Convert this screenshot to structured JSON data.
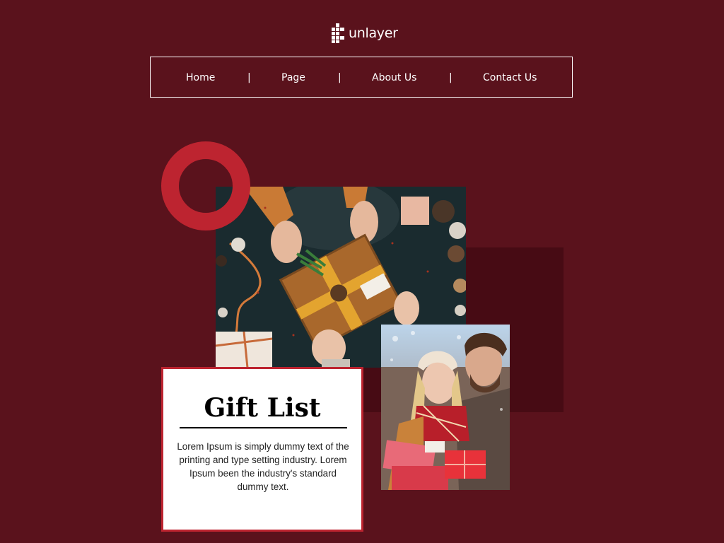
{
  "brand": {
    "name": "unlayer",
    "logo_icon": "unlayer-logo-icon"
  },
  "nav": {
    "items": [
      {
        "label": "Home"
      },
      {
        "label": "Page"
      },
      {
        "label": "About Us"
      },
      {
        "label": "Contact Us"
      }
    ],
    "separator": "|"
  },
  "card": {
    "title": "Gift List",
    "body": "Lorem Ipsum is simply dummy text of the printing and type setting industry. Lorem Ipsum been the industry's standard dummy text."
  },
  "images": {
    "gift_photo": "gift-box-on-dark-table-photo",
    "couple_photo": "couple-with-christmas-gifts-photo"
  },
  "colors": {
    "background": "#5a121c",
    "accent": "#bd2430",
    "dark_block": "#470b14",
    "text_light": "#ffffff"
  }
}
